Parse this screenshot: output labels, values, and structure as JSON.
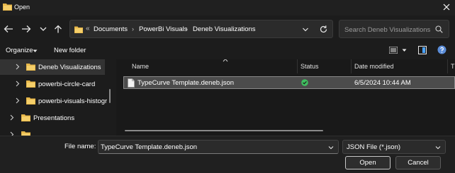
{
  "window": {
    "title": "Open"
  },
  "navigation": {
    "breadcrumbs": [
      "Documents",
      "PowerBi Visuals",
      "Deneb Visualizations"
    ],
    "overflow_chevron": "«",
    "separator": "›",
    "search_placeholder": "Search Deneb Visualizations"
  },
  "toolbar": {
    "organize_label": "Organize",
    "new_folder_label": "New folder"
  },
  "sidebar": {
    "items": [
      {
        "label": "Deneb Visualizations",
        "selected": true
      },
      {
        "label": "powerbi-circle-card",
        "selected": false
      },
      {
        "label": "powerbi-visuals-histogr",
        "selected": false
      },
      {
        "label": "Presentations",
        "selected": false
      }
    ]
  },
  "file_list": {
    "columns": [
      "Name",
      "Status",
      "Date modified",
      "T"
    ],
    "rows": [
      {
        "name": "TypeCurve Template.deneb.json",
        "status": "synced",
        "date_modified": "6/5/2024 10:44 AM"
      }
    ]
  },
  "footer": {
    "file_name_label": "File name:",
    "file_name_value": "TypeCurve Template.deneb.json",
    "file_type_value": "JSON File (*.json)",
    "open_label": "Open",
    "cancel_label": "Cancel"
  },
  "colors": {
    "folder": "#e8b84a",
    "status_ok": "#3fbf5f",
    "selection": "#4c4c4c"
  }
}
